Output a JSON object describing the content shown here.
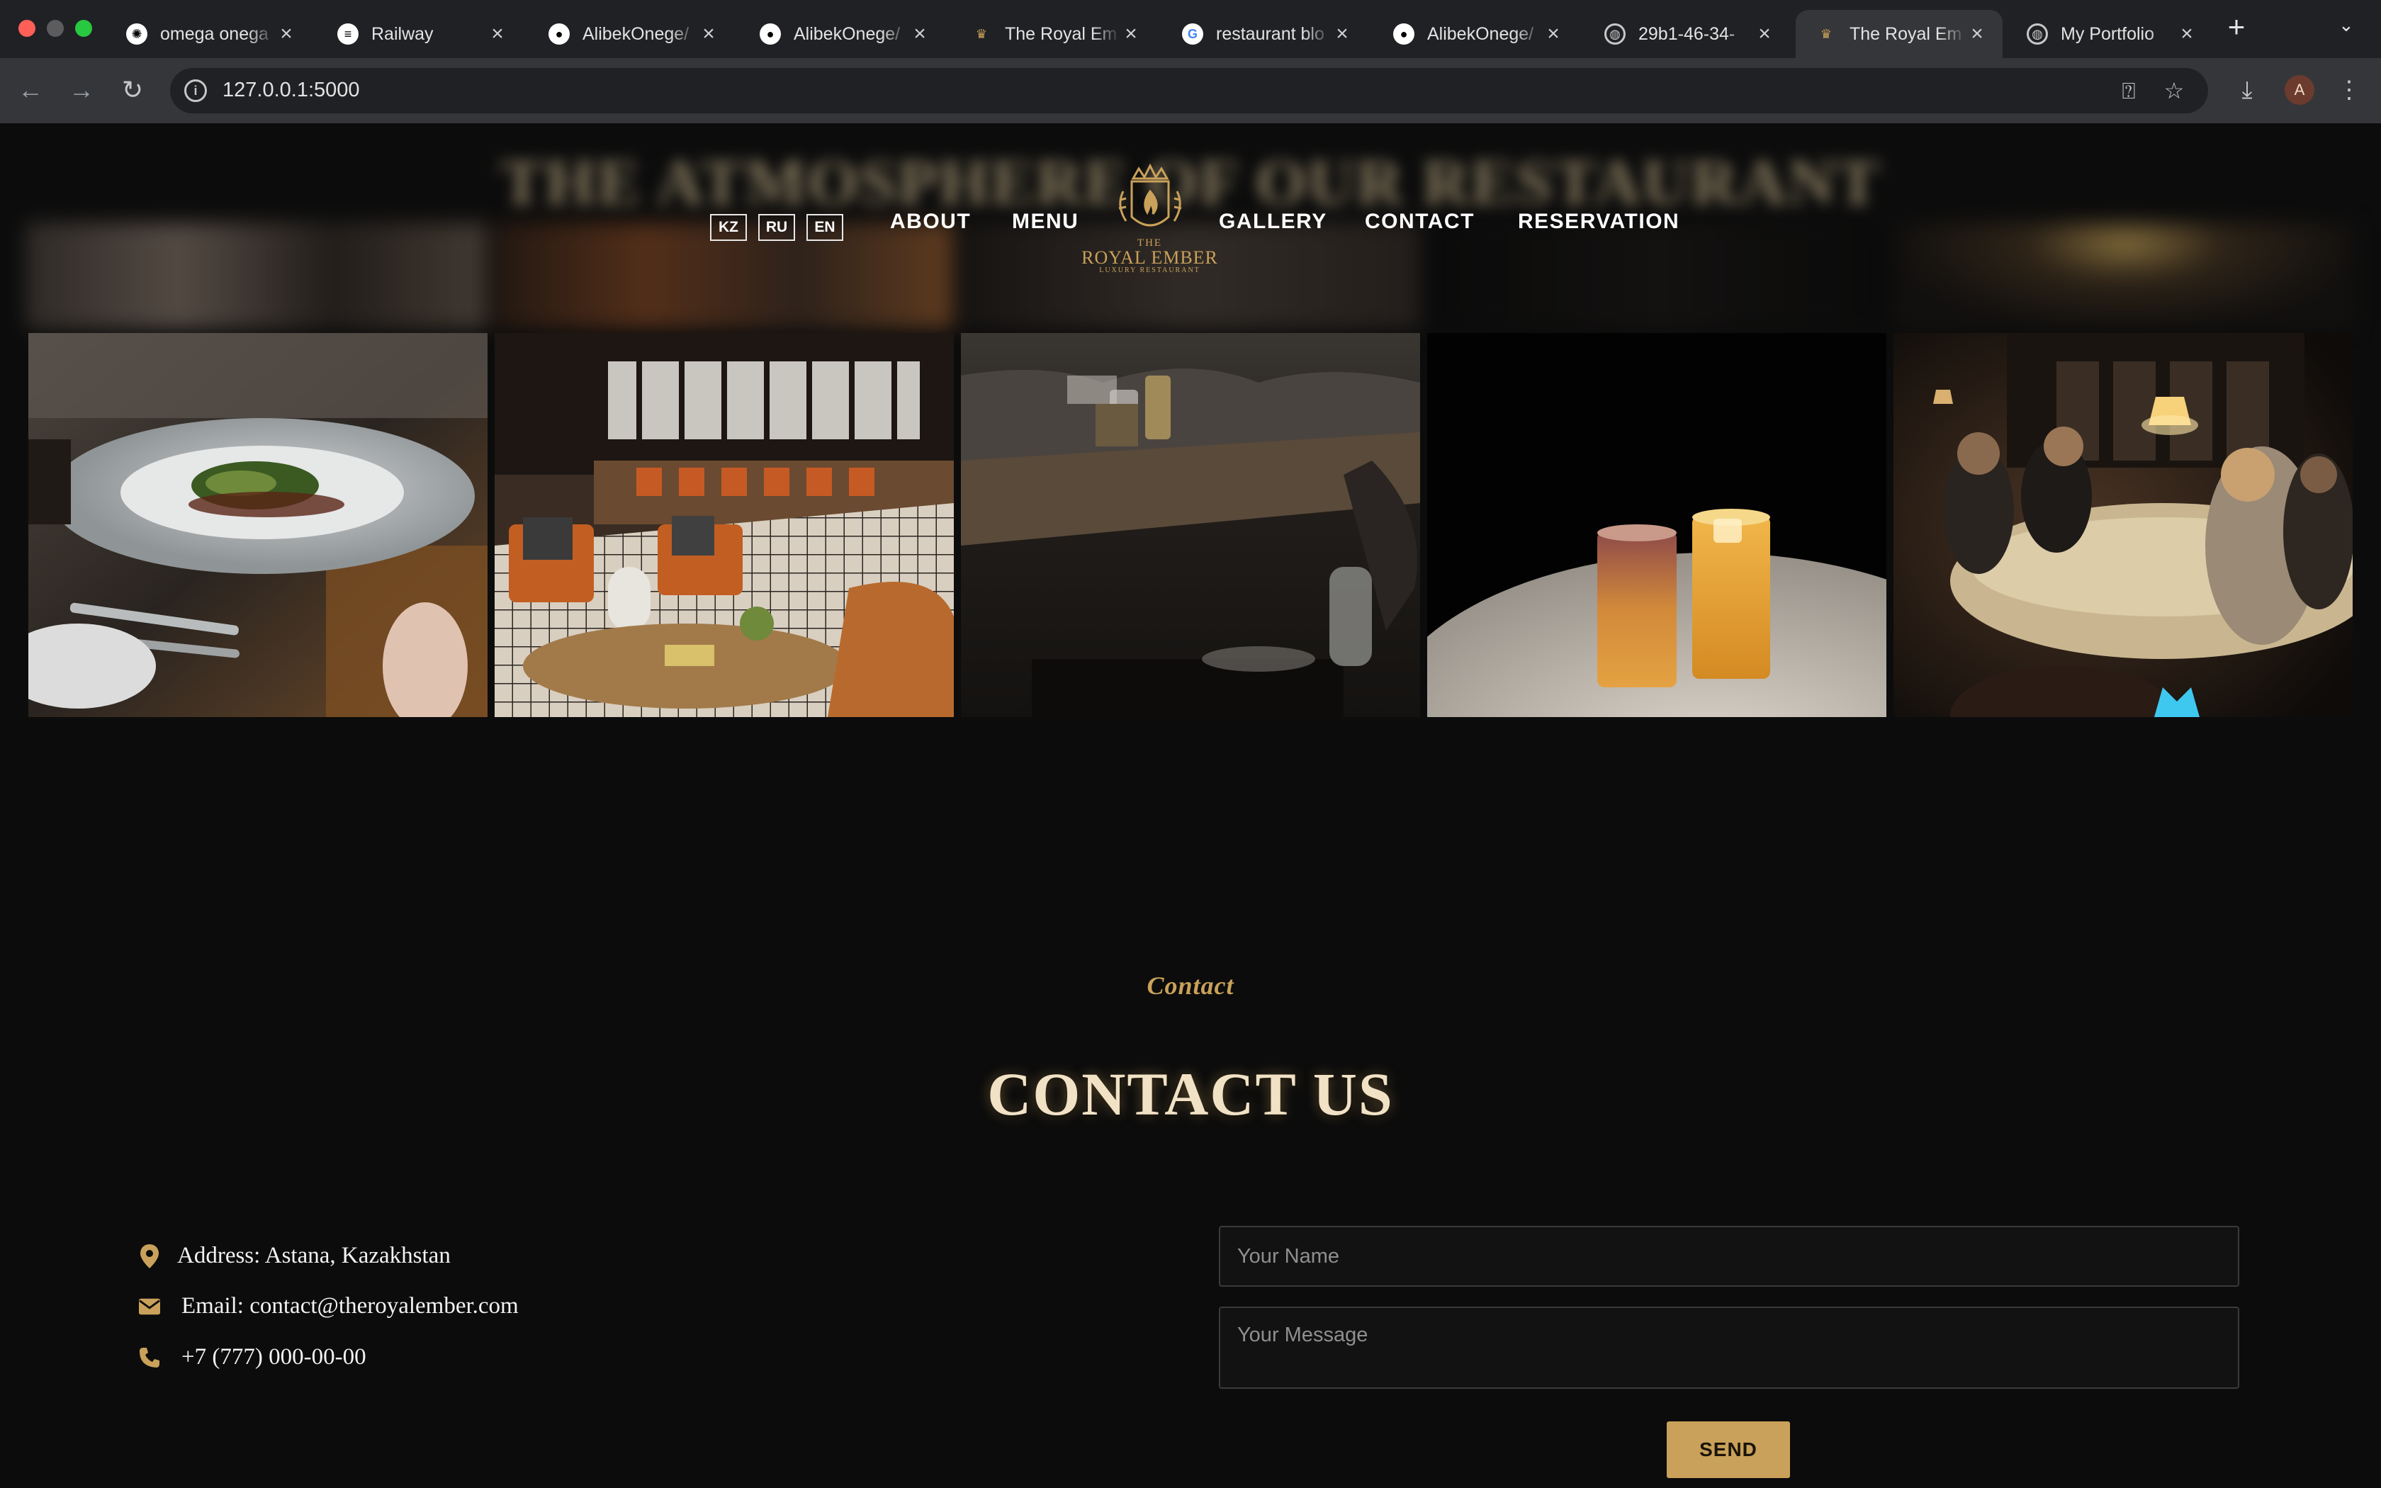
{
  "browser": {
    "tabs": [
      {
        "title": "omega onega",
        "icon": "openai-icon"
      },
      {
        "title": "Railway",
        "icon": "railway-icon"
      },
      {
        "title": "AlibekOnege/",
        "icon": "github-icon"
      },
      {
        "title": "AlibekOnege/",
        "icon": "github-icon"
      },
      {
        "title": "The Royal Em",
        "icon": "royal-ember-icon"
      },
      {
        "title": "restaurant blo",
        "icon": "google-icon"
      },
      {
        "title": "AlibekOnege/",
        "icon": "github-icon"
      },
      {
        "title": "29b1-46-34-",
        "icon": "globe-icon"
      },
      {
        "title": "The Royal Em",
        "icon": "royal-ember-icon",
        "active": true
      },
      {
        "title": "My Portfolio",
        "icon": "globe-icon"
      }
    ],
    "url": "127.0.0.1:5000",
    "profile_initial": "A"
  },
  "page": {
    "blurred_heading": "THE ATMOSPHERE OF OUR RESTAURANT",
    "languages": [
      "KZ",
      "RU",
      "EN"
    ],
    "nav": {
      "about": "ABOUT",
      "menu": "MENU",
      "gallery": "GALLERY",
      "contact": "CONTACT",
      "reservation": "RESERVATION"
    },
    "logo": {
      "line1": "THE",
      "line2": "ROYAL EMBER",
      "line3": "LUXURY RESTAURANT"
    },
    "gallery_photos": [
      "plated-dish",
      "restaurant-lounge-bar",
      "dining-booth-table",
      "cocktails-on-marble",
      "candlelit-dinner-party"
    ],
    "contact": {
      "kicker": "Contact",
      "title": "CONTACT US",
      "address": "Address: Astana, Kazakhstan",
      "email": "Email: contact@theroyalember.com",
      "phone": "+7 (777) 000-00-00"
    },
    "form": {
      "name_placeholder": "Your Name",
      "message_placeholder": "Your Message",
      "send_label": "SEND"
    },
    "colors": {
      "gold": "#c9a15a",
      "background": "#0c0c0c"
    }
  }
}
